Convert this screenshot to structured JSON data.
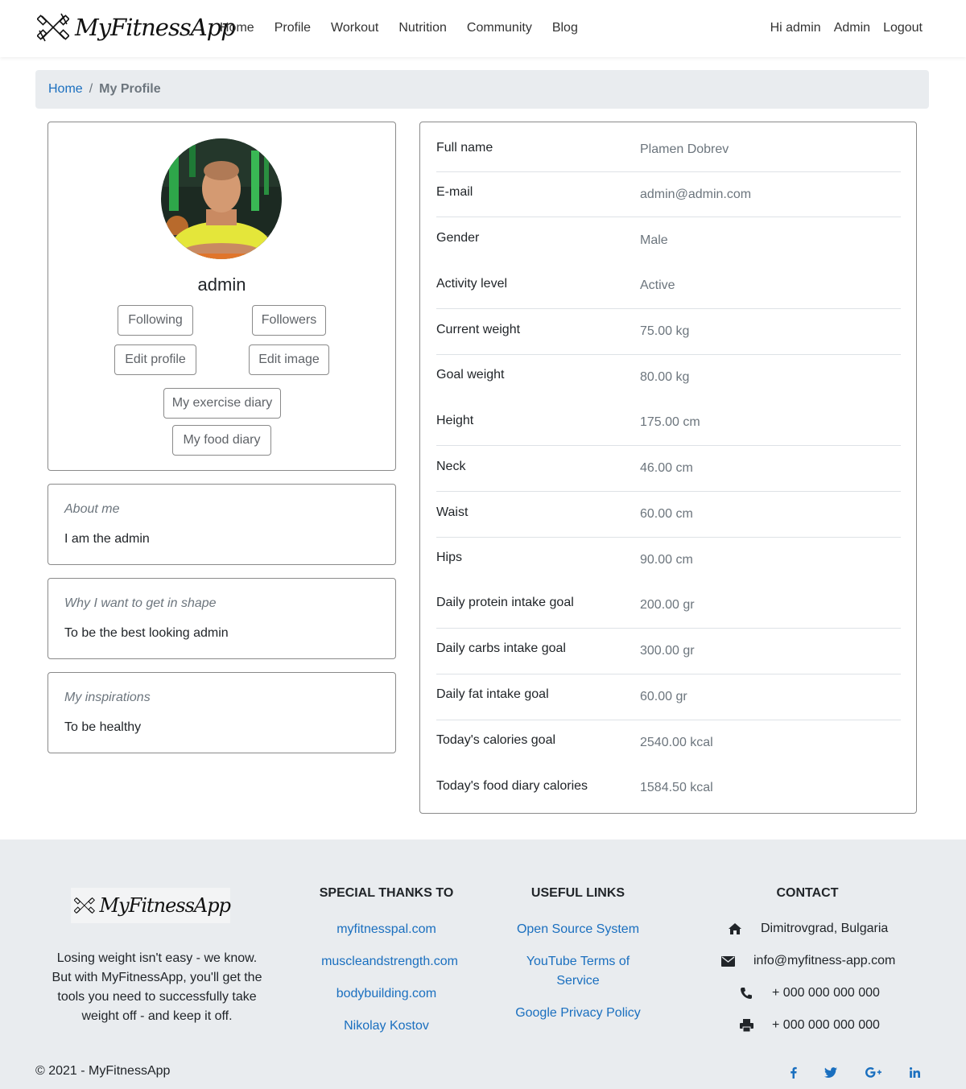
{
  "brand": {
    "name": "MyFitnessApp"
  },
  "nav": {
    "links": [
      "Home",
      "Profile",
      "Workout",
      "Nutrition",
      "Community",
      "Blog"
    ],
    "right": [
      "Hi admin",
      "Admin",
      "Logout"
    ]
  },
  "breadcrumb": {
    "home": "Home",
    "separator": "/",
    "current": "My Profile"
  },
  "profile": {
    "username": "admin",
    "buttons": {
      "following": "Following",
      "followers": "Followers",
      "edit_profile": "Edit profile",
      "edit_image": "Edit image",
      "exercise_diary": "My exercise diary",
      "food_diary": "My food diary"
    }
  },
  "about": [
    {
      "title": "About me",
      "text": "I am the admin"
    },
    {
      "title": "Why I want to get in shape",
      "text": "To be the best looking admin"
    },
    {
      "title": "My inspirations",
      "text": "To be healthy"
    }
  ],
  "details": [
    {
      "label": "Full name",
      "value": "Plamen Dobrev"
    },
    {
      "label": "E-mail",
      "value": "admin@admin.com"
    },
    {
      "label": "Gender",
      "value": "Male"
    },
    {
      "label": "Activity level",
      "value": "Active"
    },
    {
      "label": "Current weight",
      "value": "75.00 kg"
    },
    {
      "label": "Goal weight",
      "value": "80.00 kg"
    },
    {
      "label": "Height",
      "value": "175.00 cm"
    },
    {
      "label": "Neck",
      "value": "46.00 cm"
    },
    {
      "label": "Waist",
      "value": "60.00 cm"
    },
    {
      "label": "Hips",
      "value": "90.00 cm"
    },
    {
      "label": "Daily protein intake goal",
      "value": "200.00 gr"
    },
    {
      "label": "Daily carbs intake goal",
      "value": "300.00 gr"
    },
    {
      "label": "Daily fat intake goal",
      "value": "60.00 gr"
    },
    {
      "label": "Today's calories goal",
      "value": "2540.00 kcal"
    },
    {
      "label": "Today's food diary calories",
      "value": "1584.50 kcal"
    }
  ],
  "footer": {
    "about": "Losing weight isn't easy - we know. But with MyFitnessApp, you'll get the tools you need to successfully take weight off - and keep it off.",
    "thanks": {
      "title": "SPECIAL THANKS TO",
      "links": [
        "myfitnesspal.com",
        "muscleandstrength.com",
        "bodybuilding.com",
        "Nikolay Kostov"
      ]
    },
    "useful": {
      "title": "USEFUL LINKS",
      "links": [
        "Open Source System",
        "YouTube Terms of Service",
        "Google Privacy Policy"
      ]
    },
    "contact": {
      "title": "CONTACT",
      "address": "Dimitrovgrad, Bulgaria",
      "email": "info@myfitness-app.com",
      "phone": "+ 000 000 000 000",
      "fax": "+ 000 000 000 000"
    },
    "copyright": "© 2021 - MyFitnessApp",
    "social": [
      "facebook-icon",
      "twitter-icon",
      "google-plus-icon",
      "linkedin-icon"
    ]
  },
  "colors": {
    "link": "#1a6fbf",
    "muted": "#6c757d",
    "breadcrumb_bg": "#e9ecef",
    "footer_bg": "#e9ecef"
  }
}
